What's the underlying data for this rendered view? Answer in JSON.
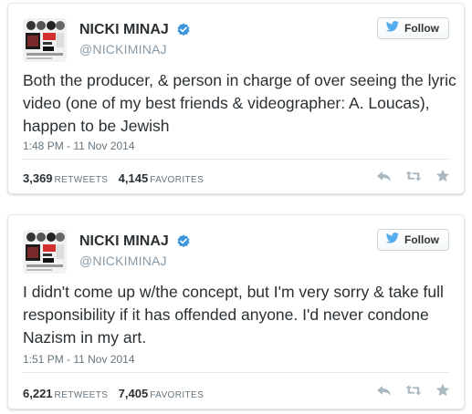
{
  "colors": {
    "twitter_blue": "#55acee",
    "verified_blue": "#3b94d9",
    "text": "#292f33",
    "muted": "#8899a6",
    "action_gray": "#aab8c2"
  },
  "tweets": [
    {
      "display_name": "NICKI MINAJ",
      "handle": "@NICKIMINAJ",
      "follow_label": "Follow",
      "text": "Both the producer, & person in charge of over seeing the lyric video (one of my best friends & videographer: A. Loucas), happen to be Jewish",
      "timestamp": "1:48 PM - 11 Nov 2014",
      "retweets": "3,369",
      "retweets_label": "RETWEETS",
      "favorites": "4,145",
      "favorites_label": "FAVORITES"
    },
    {
      "display_name": "NICKI MINAJ",
      "handle": "@NICKIMINAJ",
      "follow_label": "Follow",
      "text": "I didn't come up w/the concept, but I'm very sorry & take full responsibility if it has offended anyone. I'd never condone Nazism in my art.",
      "timestamp": "1:51 PM - 11 Nov 2014",
      "retweets": "6,221",
      "retweets_label": "RETWEETS",
      "favorites": "7,405",
      "favorites_label": "FAVORITES"
    }
  ],
  "icons": {
    "verified": "verified-badge-icon",
    "follow": "twitter-bird-icon",
    "reply": "reply-icon",
    "retweet": "retweet-icon",
    "favorite": "star-icon"
  }
}
